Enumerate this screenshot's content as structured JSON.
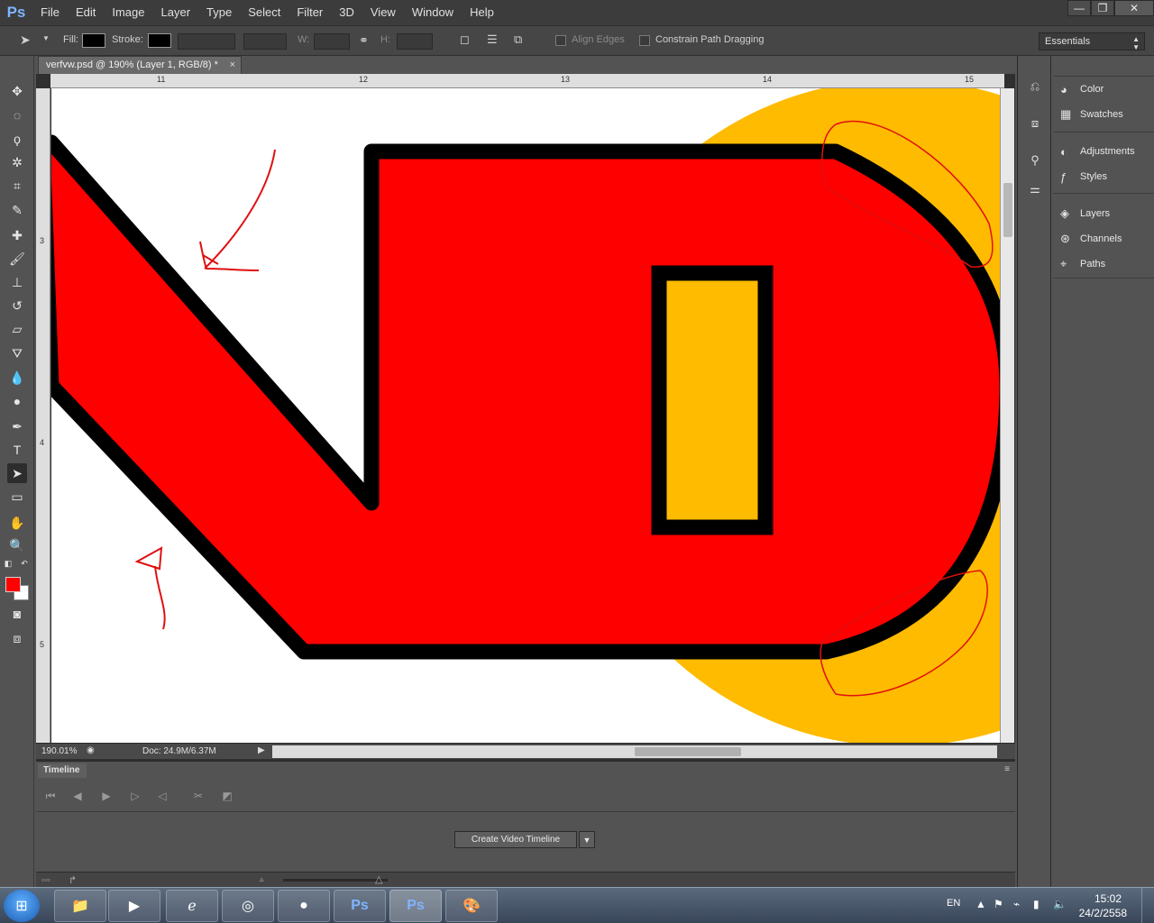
{
  "app": {
    "logo": "Ps"
  },
  "menu": [
    "File",
    "Edit",
    "Image",
    "Layer",
    "Type",
    "Select",
    "Filter",
    "3D",
    "View",
    "Window",
    "Help"
  ],
  "window_controls": {
    "minimize": "—",
    "restore": "❐",
    "close": "✕"
  },
  "options": {
    "fill_label": "Fill:",
    "stroke_label": "Stroke:",
    "w_label": "W:",
    "h_label": "H:",
    "align_edges": "Align Edges",
    "constrain_path": "Constrain Path Dragging",
    "workspace": "Essentials"
  },
  "document": {
    "tab_title": "verfvw.psd @ 190% (Layer 1, RGB/8) *",
    "close_symbol": "×",
    "ruler_top": [
      "11",
      "12",
      "13",
      "14",
      "15"
    ],
    "ruler_left": [
      "3",
      "4",
      "5"
    ]
  },
  "status": {
    "zoom": "190.01%",
    "doc_size": "Doc: 24.9M/6.37M"
  },
  "timeline": {
    "tab": "Timeline",
    "create_button": "Create Video Timeline"
  },
  "panels": {
    "items": [
      "Color",
      "Swatches",
      "Adjustments",
      "Styles",
      "Layers",
      "Channels",
      "Paths"
    ]
  },
  "taskbar": {
    "lang": "EN",
    "time": "15:02",
    "date": "24/2/2558"
  },
  "colors": {
    "foreground": "#ff0000",
    "background": "#ffffff",
    "shape_fill": "#ff0000",
    "circle_fill": "#ffbb00",
    "stroke": "#000000",
    "annotation": "#e01010"
  }
}
